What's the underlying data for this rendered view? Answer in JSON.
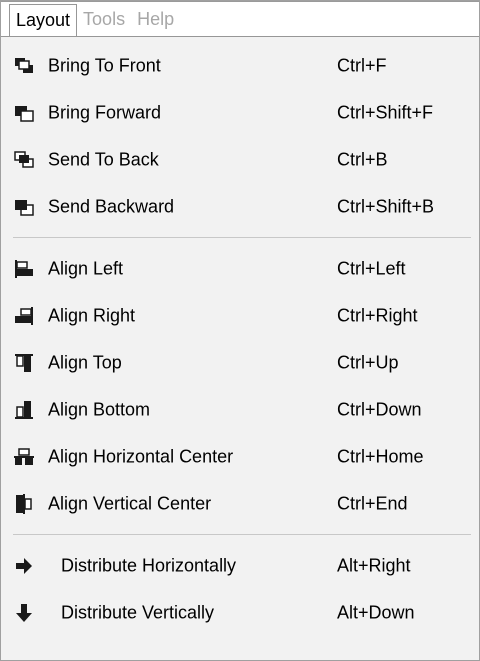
{
  "menubar": {
    "items": [
      {
        "label": "Layout",
        "active": true
      },
      {
        "label": "Tools",
        "active": false
      },
      {
        "label": "Help",
        "active": false
      }
    ]
  },
  "menu": {
    "group1": [
      {
        "label": "Bring To Front",
        "shortcut": "Ctrl+F",
        "icon": "bring-to-front-icon"
      },
      {
        "label": "Bring Forward",
        "shortcut": "Ctrl+Shift+F",
        "icon": "bring-forward-icon"
      },
      {
        "label": "Send To Back",
        "shortcut": "Ctrl+B",
        "icon": "send-to-back-icon"
      },
      {
        "label": "Send Backward",
        "shortcut": "Ctrl+Shift+B",
        "icon": "send-backward-icon"
      }
    ],
    "group2": [
      {
        "label": "Align Left",
        "shortcut": "Ctrl+Left",
        "icon": "align-left-icon"
      },
      {
        "label": "Align Right",
        "shortcut": "Ctrl+Right",
        "icon": "align-right-icon"
      },
      {
        "label": "Align Top",
        "shortcut": "Ctrl+Up",
        "icon": "align-top-icon"
      },
      {
        "label": "Align Bottom",
        "shortcut": "Ctrl+Down",
        "icon": "align-bottom-icon"
      },
      {
        "label": "Align Horizontal Center",
        "shortcut": "Ctrl+Home",
        "icon": "align-horizontal-center-icon"
      },
      {
        "label": "Align Vertical Center",
        "shortcut": "Ctrl+End",
        "icon": "align-vertical-center-icon"
      }
    ],
    "group3": [
      {
        "label": "Distribute Horizontally",
        "shortcut": "Alt+Right",
        "icon": "arrow-right-icon"
      },
      {
        "label": "Distribute Vertically",
        "shortcut": "Alt+Down",
        "icon": "arrow-down-icon"
      }
    ]
  },
  "colors": {
    "menu_background": "#f2f2f2",
    "inactive_text": "#a7a7a7",
    "icon_dark": "#1a1a1a",
    "separator": "#c8c8c8"
  }
}
